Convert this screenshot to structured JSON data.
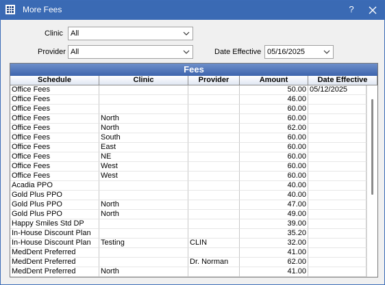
{
  "window": {
    "title": "More Fees",
    "help_label": "?"
  },
  "filters": {
    "clinic_label": "Clinic",
    "clinic_value": "All",
    "provider_label": "Provider",
    "provider_value": "All",
    "date_label": "Date Effective",
    "date_value": "05/16/2025"
  },
  "grid": {
    "title": "Fees",
    "columns": [
      "Schedule",
      "Clinic",
      "Provider",
      "Amount",
      "Date Effective"
    ],
    "rows": [
      [
        "Office Fees",
        "",
        "",
        "50.00",
        "05/12/2025"
      ],
      [
        "Office Fees",
        "",
        "",
        "46.00",
        ""
      ],
      [
        "Office Fees",
        "",
        "",
        "60.00",
        ""
      ],
      [
        "Office Fees",
        "North",
        "",
        "60.00",
        ""
      ],
      [
        "Office Fees",
        "North",
        "",
        "62.00",
        ""
      ],
      [
        "Office Fees",
        "South",
        "",
        "60.00",
        ""
      ],
      [
        "Office Fees",
        "East",
        "",
        "60.00",
        ""
      ],
      [
        "Office Fees",
        "NE",
        "",
        "60.00",
        ""
      ],
      [
        "Office Fees",
        "West",
        "",
        "60.00",
        ""
      ],
      [
        "Office Fees",
        "West",
        "",
        "60.00",
        ""
      ],
      [
        "Acadia PPO",
        "",
        "",
        "40.00",
        ""
      ],
      [
        "Gold Plus PPO",
        "",
        "",
        "40.00",
        ""
      ],
      [
        "Gold Plus PPO",
        "North",
        "",
        "47.00",
        ""
      ],
      [
        "Gold Plus PPO",
        "North",
        "",
        "49.00",
        ""
      ],
      [
        "Happy Smiles Std DP",
        "",
        "",
        "39.00",
        ""
      ],
      [
        "In-House Discount Plan",
        "",
        "",
        "35.20",
        ""
      ],
      [
        "In-House Discount Plan",
        "Testing",
        "CLIN",
        "32.00",
        ""
      ],
      [
        "MedDent Preferred",
        "",
        "",
        "41.00",
        ""
      ],
      [
        "MedDent Preferred",
        "",
        "Dr. Norman",
        "62.00",
        ""
      ],
      [
        "MedDent Preferred",
        "North",
        "",
        "41.00",
        ""
      ]
    ]
  },
  "icons": {
    "app": "grid-app-icon",
    "close": "close-icon",
    "chevron": "chevron-down-icon"
  },
  "colors": {
    "titlebar": "#3a6ab4",
    "grid_title": "#3d64ad"
  }
}
